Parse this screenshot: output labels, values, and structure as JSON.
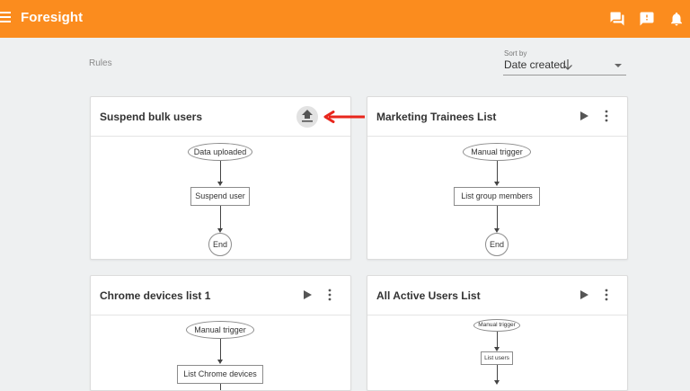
{
  "app": {
    "title": "Foresight"
  },
  "header_icons": [
    "feedback-icon",
    "report-icon",
    "notifications-icon"
  ],
  "page": {
    "section_label": "Rules"
  },
  "sort": {
    "label": "Sort by",
    "value": "Date created"
  },
  "colors": {
    "topbar": "#fb8c1e",
    "annotation_arrow": "#e8261c"
  },
  "cards": [
    {
      "title": "Suspend bulk users",
      "action_icon": "upload-icon",
      "flow": {
        "trigger": "Data uploaded",
        "action": "Suspend user",
        "end": "End"
      }
    },
    {
      "title": "Marketing Trainees List",
      "action_icon": "play-icon",
      "flow": {
        "trigger": "Manual trigger",
        "action": "List group members",
        "end": "End"
      }
    },
    {
      "title": "Chrome devices list 1",
      "action_icon": "play-icon",
      "flow": {
        "trigger": "Manual trigger",
        "action": "List Chrome devices"
      }
    },
    {
      "title": "All Active Users List",
      "action_icon": "play-icon",
      "flow": {
        "trigger": "Manual trigger",
        "action": "List users"
      }
    }
  ]
}
